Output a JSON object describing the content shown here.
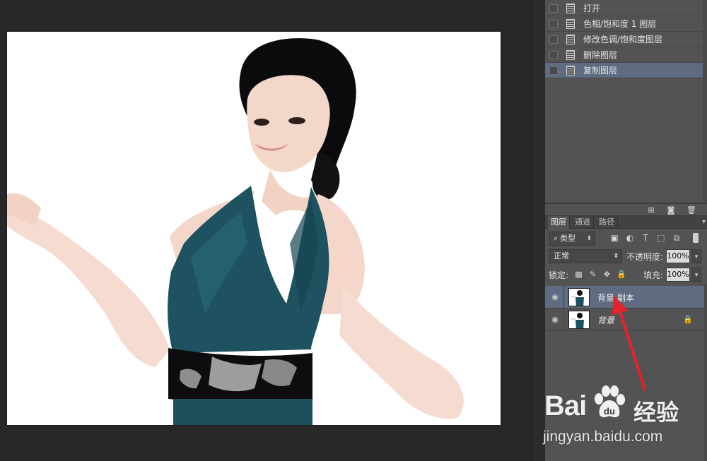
{
  "history": {
    "items": [
      {
        "label": "打开",
        "active": false
      },
      {
        "label": "色相/饱和度 1 图层",
        "active": false
      },
      {
        "label": "修改色调/饱和度图层",
        "active": false
      },
      {
        "label": "删除图层",
        "active": false
      },
      {
        "label": "复制图层",
        "active": true
      }
    ],
    "footer_icons": [
      "new-snapshot-icon",
      "camera-icon",
      "trash-icon"
    ]
  },
  "layers_panel": {
    "tabs": [
      {
        "label": "图层",
        "active": true
      },
      {
        "label": "通道",
        "active": false
      },
      {
        "label": "路径",
        "active": false
      }
    ],
    "filter": {
      "search_glyph": "⌕",
      "kind_label": "类型",
      "filter_icons": [
        "image-filter-icon",
        "adjustment-filter-icon",
        "type-filter-icon",
        "shape-filter-icon",
        "smart-object-filter-icon"
      ]
    },
    "blend_mode": "正常",
    "opacity_label": "不透明度:",
    "opacity_value": "100%",
    "lock_label": "锁定:",
    "lock_icons": [
      "lock-transparent-icon",
      "lock-pixels-icon",
      "lock-position-icon",
      "lock-all-icon"
    ],
    "fill_label": "填充:",
    "fill_value": "100%",
    "layers": [
      {
        "name": "背景 副本",
        "active": true,
        "visible": true,
        "locked": false,
        "italic": false
      },
      {
        "name": "背景",
        "active": false,
        "visible": true,
        "locked": true,
        "italic": true
      }
    ]
  },
  "annotation": {
    "arrow_color": "#e8202a"
  },
  "watermark": {
    "brand_left": "Bai",
    "brand_right": "经验",
    "url": "jingyan.baidu.com"
  },
  "colors": {
    "panel_bg": "#535353",
    "workspace_bg": "#282828",
    "selection": "#5f6b80"
  }
}
